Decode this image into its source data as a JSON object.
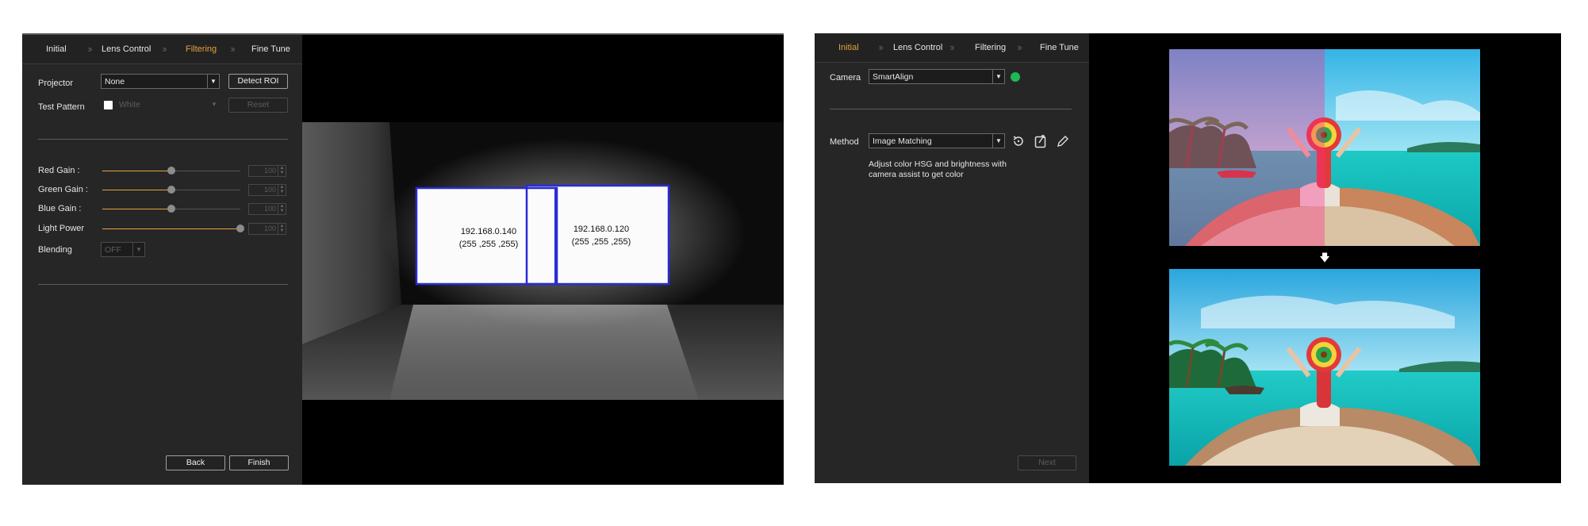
{
  "left_window": {
    "steps": [
      {
        "label": "Initial",
        "active": false
      },
      {
        "label": "Lens Control",
        "active": false
      },
      {
        "label": "Filtering",
        "active": true
      },
      {
        "label": "Fine Tune",
        "active": false
      }
    ],
    "projector": {
      "label": "Projector",
      "value": "None",
      "detect_button": "Detect ROI"
    },
    "test_pattern": {
      "label": "Test Pattern",
      "value": "White",
      "checked": false,
      "reset_button": "Reset"
    },
    "sliders": [
      {
        "label": "Red Gain :",
        "value": "100",
        "level": 0.5
      },
      {
        "label": "Green Gain :",
        "value": "100",
        "level": 0.5
      },
      {
        "label": "Blue Gain :",
        "value": "100",
        "level": 0.5
      },
      {
        "label": "Light Power",
        "value": "100",
        "level": 1.0
      }
    ],
    "blending": {
      "label": "Blending",
      "value": "OFF"
    },
    "back_button": "Back",
    "finish_button": "Finish",
    "projection": {
      "left_screen": {
        "ip": "192.168.0.140",
        "rgb": "(255 ,255 ,255)"
      },
      "right_screen": {
        "ip": "192.168.0.120",
        "rgb": "(255 ,255 ,255)"
      },
      "roi_color": "#2a2ad8"
    },
    "accent_color": "#e6a23c"
  },
  "right_window": {
    "steps": [
      {
        "label": "Initial",
        "active": true
      },
      {
        "label": "Lens Control",
        "active": false
      },
      {
        "label": "Filtering",
        "active": false
      },
      {
        "label": "Fine Tune",
        "active": false
      }
    ],
    "camera": {
      "label": "Camera",
      "value": "SmartAlign",
      "status_color": "#1db954"
    },
    "method": {
      "label": "Method",
      "value": "Image Matching",
      "description_line1": "Adjust color HSG and brightness with",
      "description_line2": "camera assist to get color",
      "icons": [
        "reset-icon",
        "export-icon",
        "edit-icon"
      ]
    },
    "next_button": "Next",
    "preview": {
      "arrow": "🡇"
    }
  }
}
